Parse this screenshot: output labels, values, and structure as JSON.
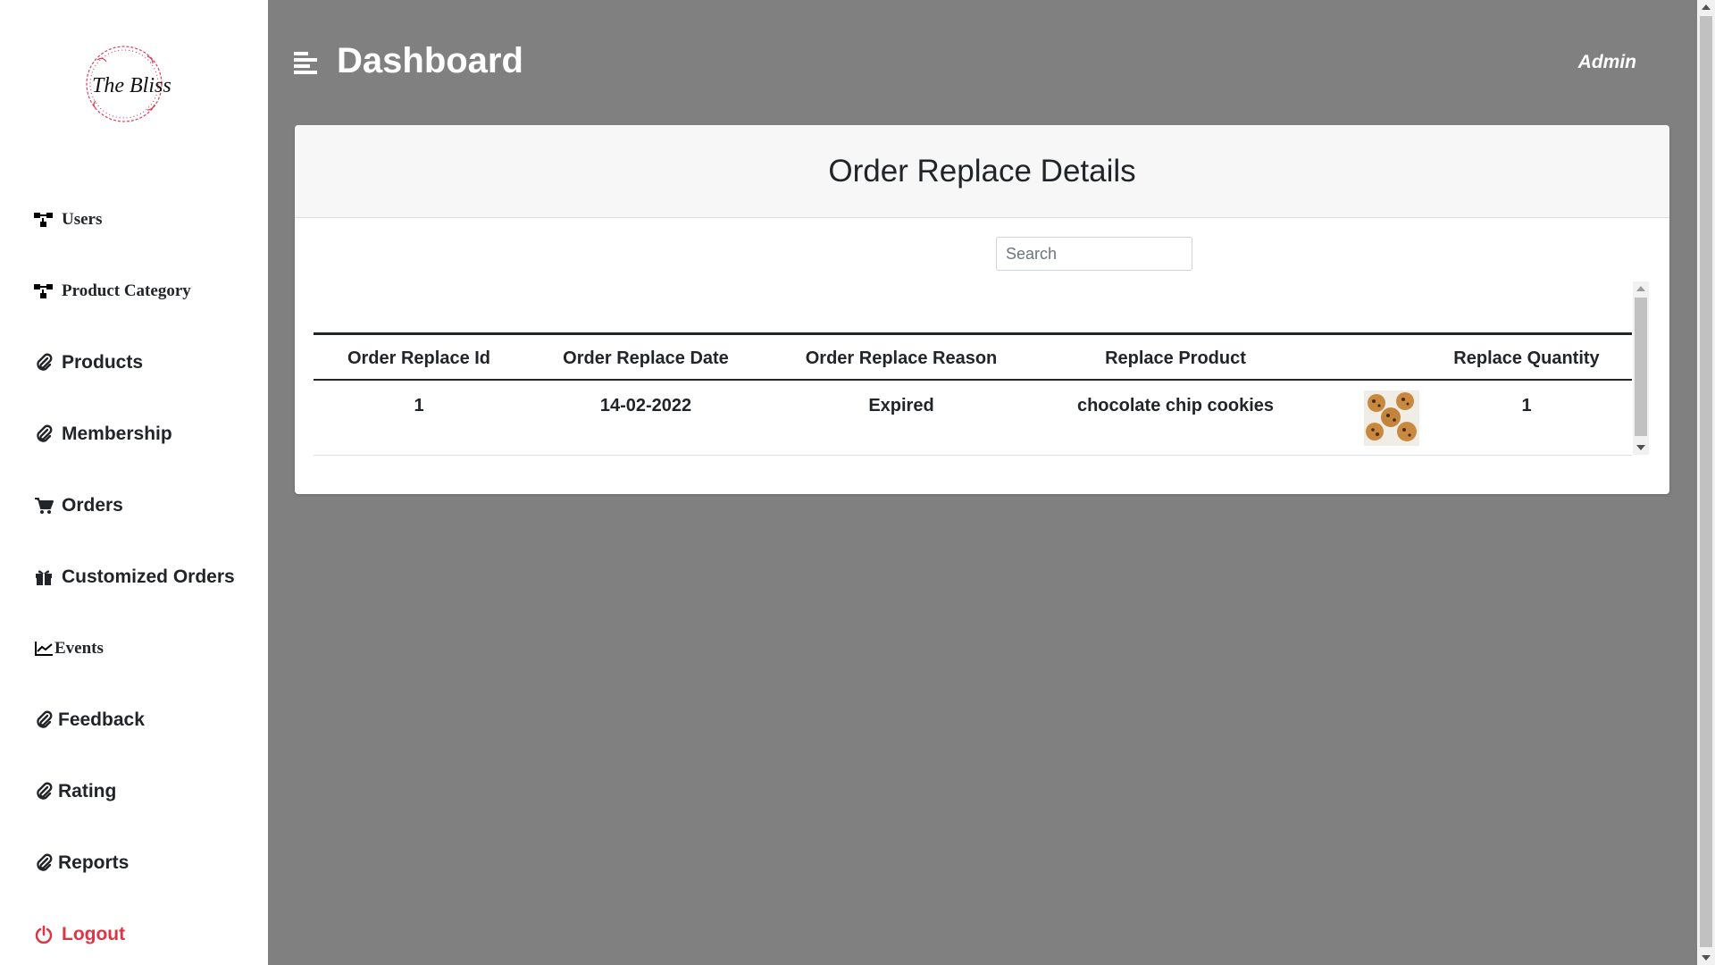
{
  "logo": {
    "text": "The Bliss"
  },
  "sidebar": {
    "items": [
      {
        "label": "Users",
        "icon": "sitemap-icon"
      },
      {
        "label": "Product Category",
        "icon": "sitemap-icon"
      },
      {
        "label": "Products",
        "icon": "paperclip-icon"
      },
      {
        "label": "Membership",
        "icon": "paperclip-icon"
      },
      {
        "label": "Orders",
        "icon": "cart-icon"
      },
      {
        "label": "Customized Orders",
        "icon": "gift-icon"
      },
      {
        "label": "Events",
        "icon": "line-chart-icon"
      },
      {
        "label": "Feedback",
        "icon": "paperclip-icon"
      },
      {
        "label": "Rating",
        "icon": "paperclip-icon"
      },
      {
        "label": "Reports",
        "icon": "paperclip-icon"
      },
      {
        "label": "Logout",
        "icon": "power-icon"
      }
    ]
  },
  "header": {
    "title": "Dashboard",
    "user": "Admin"
  },
  "card": {
    "title": "Order Replace Details",
    "search_placeholder": "Search"
  },
  "table": {
    "columns": [
      "Order Replace Id",
      "Order Replace Date",
      "Order Replace Reason",
      "Replace Product",
      "Replace Quantity"
    ],
    "rows": [
      {
        "id": "1",
        "date": "14-02-2022",
        "reason": "Expired",
        "product": "chocolate chip cookies",
        "quantity": "1"
      }
    ]
  },
  "colors": {
    "background": "#808080",
    "logout": "#dc3545",
    "logo_wreath": "#d9415b"
  }
}
